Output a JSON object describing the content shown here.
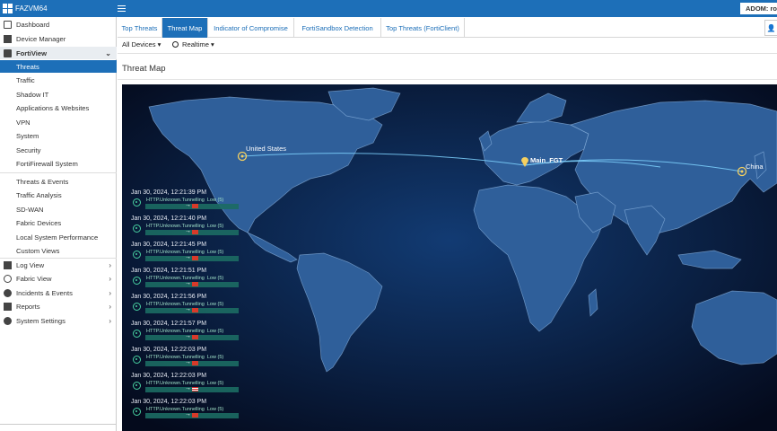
{
  "app": {
    "title": "FAZVM64",
    "adom": "ADOM: ro"
  },
  "sidebar": {
    "top_items": [
      {
        "label": "Dashboard",
        "icon": "dashboard-icon"
      },
      {
        "label": "Device Manager",
        "icon": "device-icon"
      },
      {
        "label": "FortiView",
        "icon": "fortiview-icon"
      }
    ],
    "fortiview_items": [
      "Threats",
      "Traffic",
      "Shadow IT",
      "Applications & Websites",
      "VPN",
      "System",
      "Security",
      "FortiFirewall System"
    ],
    "extra_items": [
      "Threats & Events",
      "Traffic Analysis",
      "SD-WAN",
      "Fabric Devices",
      "Local System Performance",
      "Custom Views"
    ],
    "bottom_items": [
      {
        "label": "Log View",
        "icon": "log-icon"
      },
      {
        "label": "Fabric View",
        "icon": "fabric-icon"
      },
      {
        "label": "Incidents & Events",
        "icon": "incidents-icon"
      },
      {
        "label": "Reports",
        "icon": "reports-icon"
      },
      {
        "label": "System Settings",
        "icon": "settings-icon"
      }
    ]
  },
  "tabs": [
    "Top Threats",
    "Threat Map",
    "Indicator of Compromise",
    "FortiSandbox Detection",
    "Top Threats (FortiClient)"
  ],
  "filters": {
    "devices": "All Devices",
    "time": "Realtime"
  },
  "page": {
    "title": "Threat Map"
  },
  "map": {
    "cities": [
      "United States",
      "Main_FGT",
      "China"
    ]
  },
  "events": [
    {
      "time": "Jan 30, 2024, 12:21:39 PM",
      "name": "HTTP.Unknown.Tunnelling",
      "level": "Low (5)",
      "origin": "CN"
    },
    {
      "time": "Jan 30, 2024, 12:21:40 PM",
      "name": "HTTP.Unknown.Tunnelling",
      "level": "Low (5)",
      "origin": "CN"
    },
    {
      "time": "Jan 30, 2024, 12:21:45 PM",
      "name": "HTTP.Unknown.Tunnelling",
      "level": "Low (5)",
      "origin": "CN"
    },
    {
      "time": "Jan 30, 2024, 12:21:51 PM",
      "name": "HTTP.Unknown.Tunnelling",
      "level": "Low (5)",
      "origin": "CN"
    },
    {
      "time": "Jan 30, 2024, 12:21:56 PM",
      "name": "HTTP.Unknown.Tunnelling",
      "level": "Low (5)",
      "origin": "CN"
    },
    {
      "time": "Jan 30, 2024, 12:21:57 PM",
      "name": "HTTP.Unknown.Tunnelling",
      "level": "Low (5)",
      "origin": "CN"
    },
    {
      "time": "Jan 30, 2024, 12:22:03 PM",
      "name": "HTTP.Unknown.Tunnelling",
      "level": "Low (5)",
      "origin": "CN"
    },
    {
      "time": "Jan 30, 2024, 12:22:03 PM",
      "name": "HTTP.Unknown.Tunnelling",
      "level": "Low (5)",
      "origin": "US"
    },
    {
      "time": "Jan 30, 2024, 12:22:03 PM",
      "name": "HTTP.Unknown.Tunnelling",
      "level": "Low (5)",
      "origin": "CN"
    }
  ],
  "colors": {
    "accent": "#1d6fb8",
    "map_bg": "#06102a",
    "land": "#2f5f9a",
    "event_green": "#48d0a0"
  }
}
